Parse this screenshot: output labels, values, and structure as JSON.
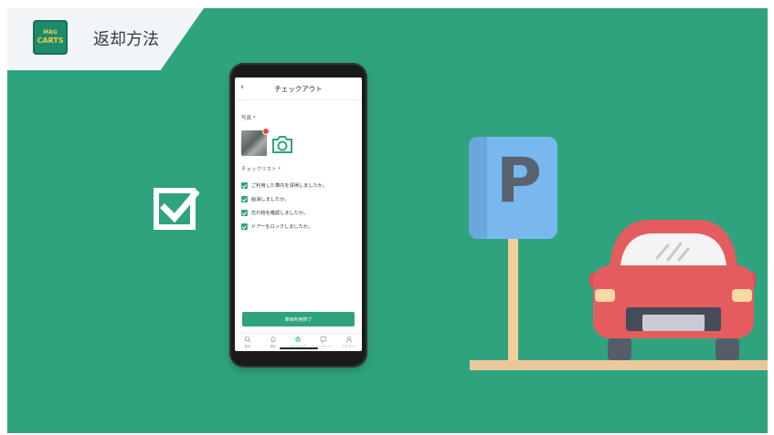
{
  "header": {
    "logo_top": "MAG",
    "logo_text": "CARTS",
    "title": "返却方法"
  },
  "phone": {
    "nav_title": "チェックアウト",
    "photo_label": "写真 *",
    "checklist_label": "チェックリスト *",
    "checklist": [
      "ご利用した車内を清掃しましたか。",
      "給油しましたか。",
      "忘れ物を確認しましたか。",
      "ドアーをロックしましたか。"
    ],
    "complete_button": "車両利用終了",
    "tabs": [
      {
        "label": "検索",
        "icon": "search-icon"
      },
      {
        "label": "通知",
        "icon": "bell-icon"
      },
      {
        "label": "カーシェア",
        "icon": "car-share-icon"
      },
      {
        "label": "メッセージ",
        "icon": "message-icon"
      },
      {
        "label": "アカウント",
        "icon": "account-icon"
      }
    ]
  },
  "illustration": {
    "parking_letter": "P"
  },
  "colors": {
    "background": "#2fa37e",
    "sign": "#79b8ef",
    "car": "#e55c5f",
    "pole": "#f3cf9b"
  }
}
